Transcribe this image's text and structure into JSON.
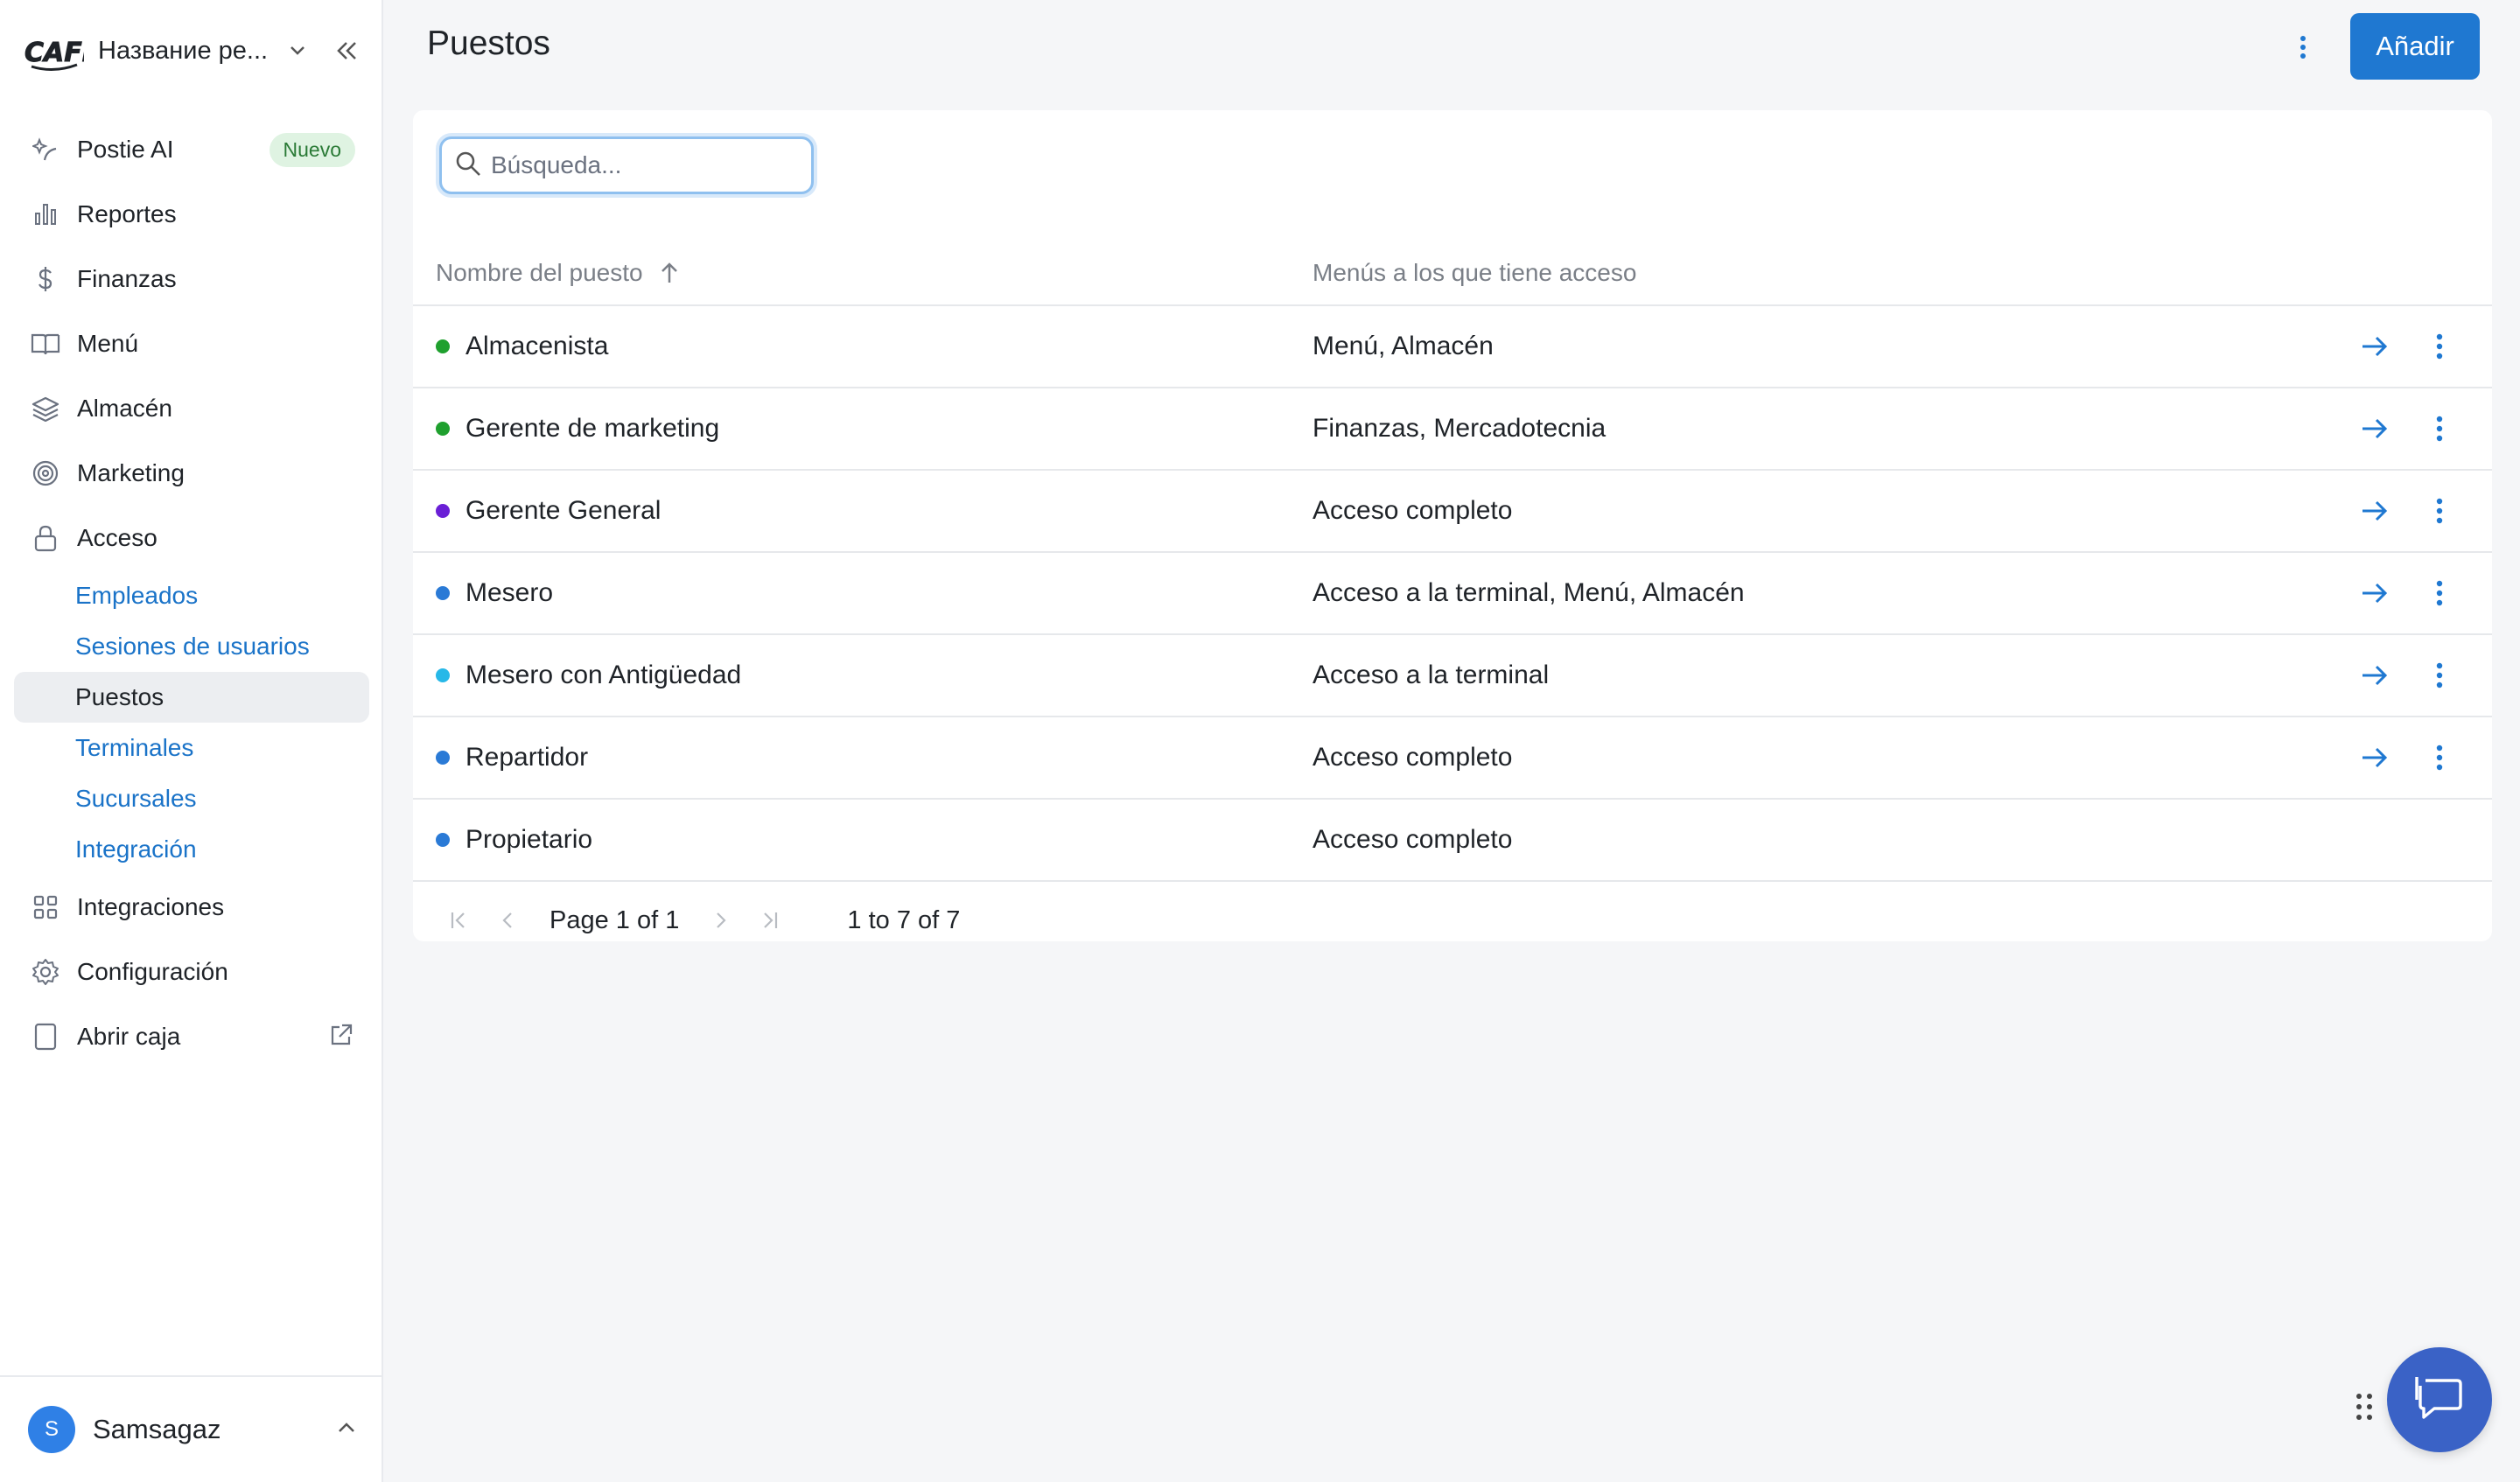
{
  "sidebar": {
    "brand_name": "Название ре...",
    "logo_text": "CAFE",
    "nav": [
      {
        "label": "Postie AI",
        "icon": "ai-sparkle-icon",
        "badge": "Nuevo"
      },
      {
        "label": "Reportes",
        "icon": "bar-chart-icon"
      },
      {
        "label": "Finanzas",
        "icon": "dollar-icon"
      },
      {
        "label": "Menú",
        "icon": "book-icon"
      },
      {
        "label": "Almacén",
        "icon": "layers-icon"
      },
      {
        "label": "Marketing",
        "icon": "target-icon"
      },
      {
        "label": "Acceso",
        "icon": "lock-icon"
      }
    ],
    "access_sub": [
      {
        "label": "Empleados"
      },
      {
        "label": "Sesiones de usuarios"
      },
      {
        "label": "Puestos",
        "active": true
      },
      {
        "label": "Terminales"
      },
      {
        "label": "Sucursales"
      },
      {
        "label": "Integración"
      }
    ],
    "nav_bottom": [
      {
        "label": "Integraciones",
        "icon": "grid-icon"
      },
      {
        "label": "Configuración",
        "icon": "gear-icon"
      },
      {
        "label": "Abrir caja",
        "icon": "tablet-icon"
      }
    ],
    "user": {
      "initial": "S",
      "name": "Samsagaz"
    }
  },
  "header": {
    "title": "Puestos",
    "add_label": "Añadir"
  },
  "search": {
    "placeholder": "Búsqueda..."
  },
  "table": {
    "columns": [
      "Nombre del puesto",
      "Menús a los que tiene acceso"
    ],
    "rows": [
      {
        "name": "Almacenista",
        "access": "Menú, Almacén",
        "color": "#1fa02e"
      },
      {
        "name": "Gerente de marketing",
        "access": "Finanzas, Mercadotecnia",
        "color": "#1fa02e"
      },
      {
        "name": "Gerente General",
        "access": "Acceso completo",
        "color": "#6a1fd6"
      },
      {
        "name": "Mesero",
        "access": "Acceso a la terminal, Menú, Almacén",
        "color": "#2a7ad6"
      },
      {
        "name": "Mesero con Antigüedad",
        "access": "Acceso a la terminal",
        "color": "#27b8e8"
      },
      {
        "name": "Repartidor",
        "access": "Acceso completo",
        "color": "#2a7ad6"
      },
      {
        "name": "Propietario",
        "access": "Acceso completo",
        "color": "#2a7ad6"
      }
    ]
  },
  "pager": {
    "page_word": "Page",
    "page": "1",
    "of_word": "of",
    "total_pages": "1",
    "range": "1 to 7 of 7"
  },
  "colors": {
    "accent": "#1f78d1",
    "chat": "#3a62c6"
  }
}
